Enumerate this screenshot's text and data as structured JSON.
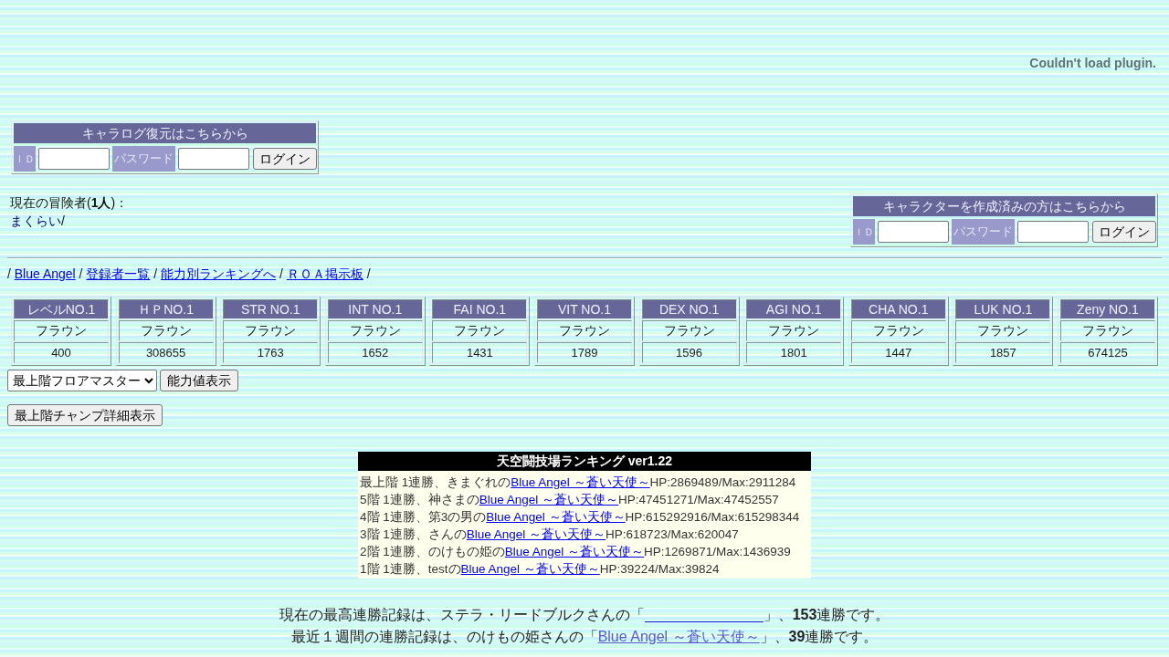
{
  "plugin_notice": "Couldn't load plugin.",
  "chara_log_login": {
    "title": "キャラログ復元はこちらから",
    "id_label": "ＩＤ",
    "password_label": "パスワード",
    "button": "ログイン"
  },
  "adventurers": {
    "label": "現在の冒険者(**1人**)：",
    "names": [
      "まくらい"
    ],
    "separator": "/"
  },
  "character_login": {
    "title": "キャラクターを作成済みの方はこちらから",
    "id_label": "ＩＤ",
    "password_label": "パスワード",
    "button": "ログイン"
  },
  "nav": {
    "separator": "/",
    "links": [
      "Blue Angel",
      "登録者一覧",
      "能力別ランキングへ",
      "ＲＯＡ掲示板"
    ]
  },
  "stat_rankings": [
    {
      "title": "レベルNO.1",
      "name": "フラウン",
      "value": "400"
    },
    {
      "title": "ＨＰNO.1",
      "name": "フラウン",
      "value": "308655"
    },
    {
      "title": "STR NO.1",
      "name": "フラウン",
      "value": "1763"
    },
    {
      "title": "INT NO.1",
      "name": "フラウン",
      "value": "1652"
    },
    {
      "title": "FAI NO.1",
      "name": "フラウン",
      "value": "1431"
    },
    {
      "title": "VIT NO.1",
      "name": "フラウン",
      "value": "1789"
    },
    {
      "title": "DEX NO.1",
      "name": "フラウン",
      "value": "1596"
    },
    {
      "title": "AGI NO.1",
      "name": "フラウン",
      "value": "1801"
    },
    {
      "title": "CHA NO.1",
      "name": "フラウン",
      "value": "1447"
    },
    {
      "title": "LUK NO.1",
      "name": "フラウン",
      "value": "1857"
    },
    {
      "title": "Zeny NO.1",
      "name": "フラウン",
      "value": "674125"
    }
  ],
  "floor_select": {
    "value": "最上階フロアマスター"
  },
  "show_stats_button": "能力値表示",
  "champ_detail_button": "最上階チャンプ詳細表示",
  "arena_ranking": {
    "title": "天空闘技場ランキング ver1.22",
    "entries": [
      {
        "text": "最上階 1連勝、きまぐれの",
        "link": "Blue Angel ～蒼い天使～",
        "hp": "HP:2869489/Max:2911284"
      },
      {
        "text": "5階 1連勝、神さまの",
        "link": "Blue Angel ～蒼い天使～",
        "hp": "HP:47451271/Max:47452557"
      },
      {
        "text": "4階 1連勝、第3の男の",
        "link": "Blue Angel ～蒼い天使～",
        "hp": "HP:615292916/Max:615298344"
      },
      {
        "text": "3階 1連勝、さんの",
        "link": "Blue Angel ～蒼い天使～",
        "hp": "HP:618723/Max:620047"
      },
      {
        "text": "2階 1連勝、のけもの姫の",
        "link": "Blue Angel ～蒼い天使～",
        "hp": "HP:1269871/Max:1436939"
      },
      {
        "text": "1階 1連勝、testの",
        "link": "Blue Angel ～蒼い天使～",
        "hp": "HP:39224/Max:39824"
      }
    ]
  },
  "records": [
    {
      "kind": "blank_link",
      "before": "現在の最高連勝記録は、ステラ・リードブルクさんの「",
      "after": "」、**153**連勝です。"
    },
    {
      "kind": "text_link",
      "before": "最近１週間の連勝記録は、のけもの姫さんの「",
      "link": "Blue Angel ～蒼い天使～",
      "after": "」、**39**連勝です。"
    }
  ]
}
